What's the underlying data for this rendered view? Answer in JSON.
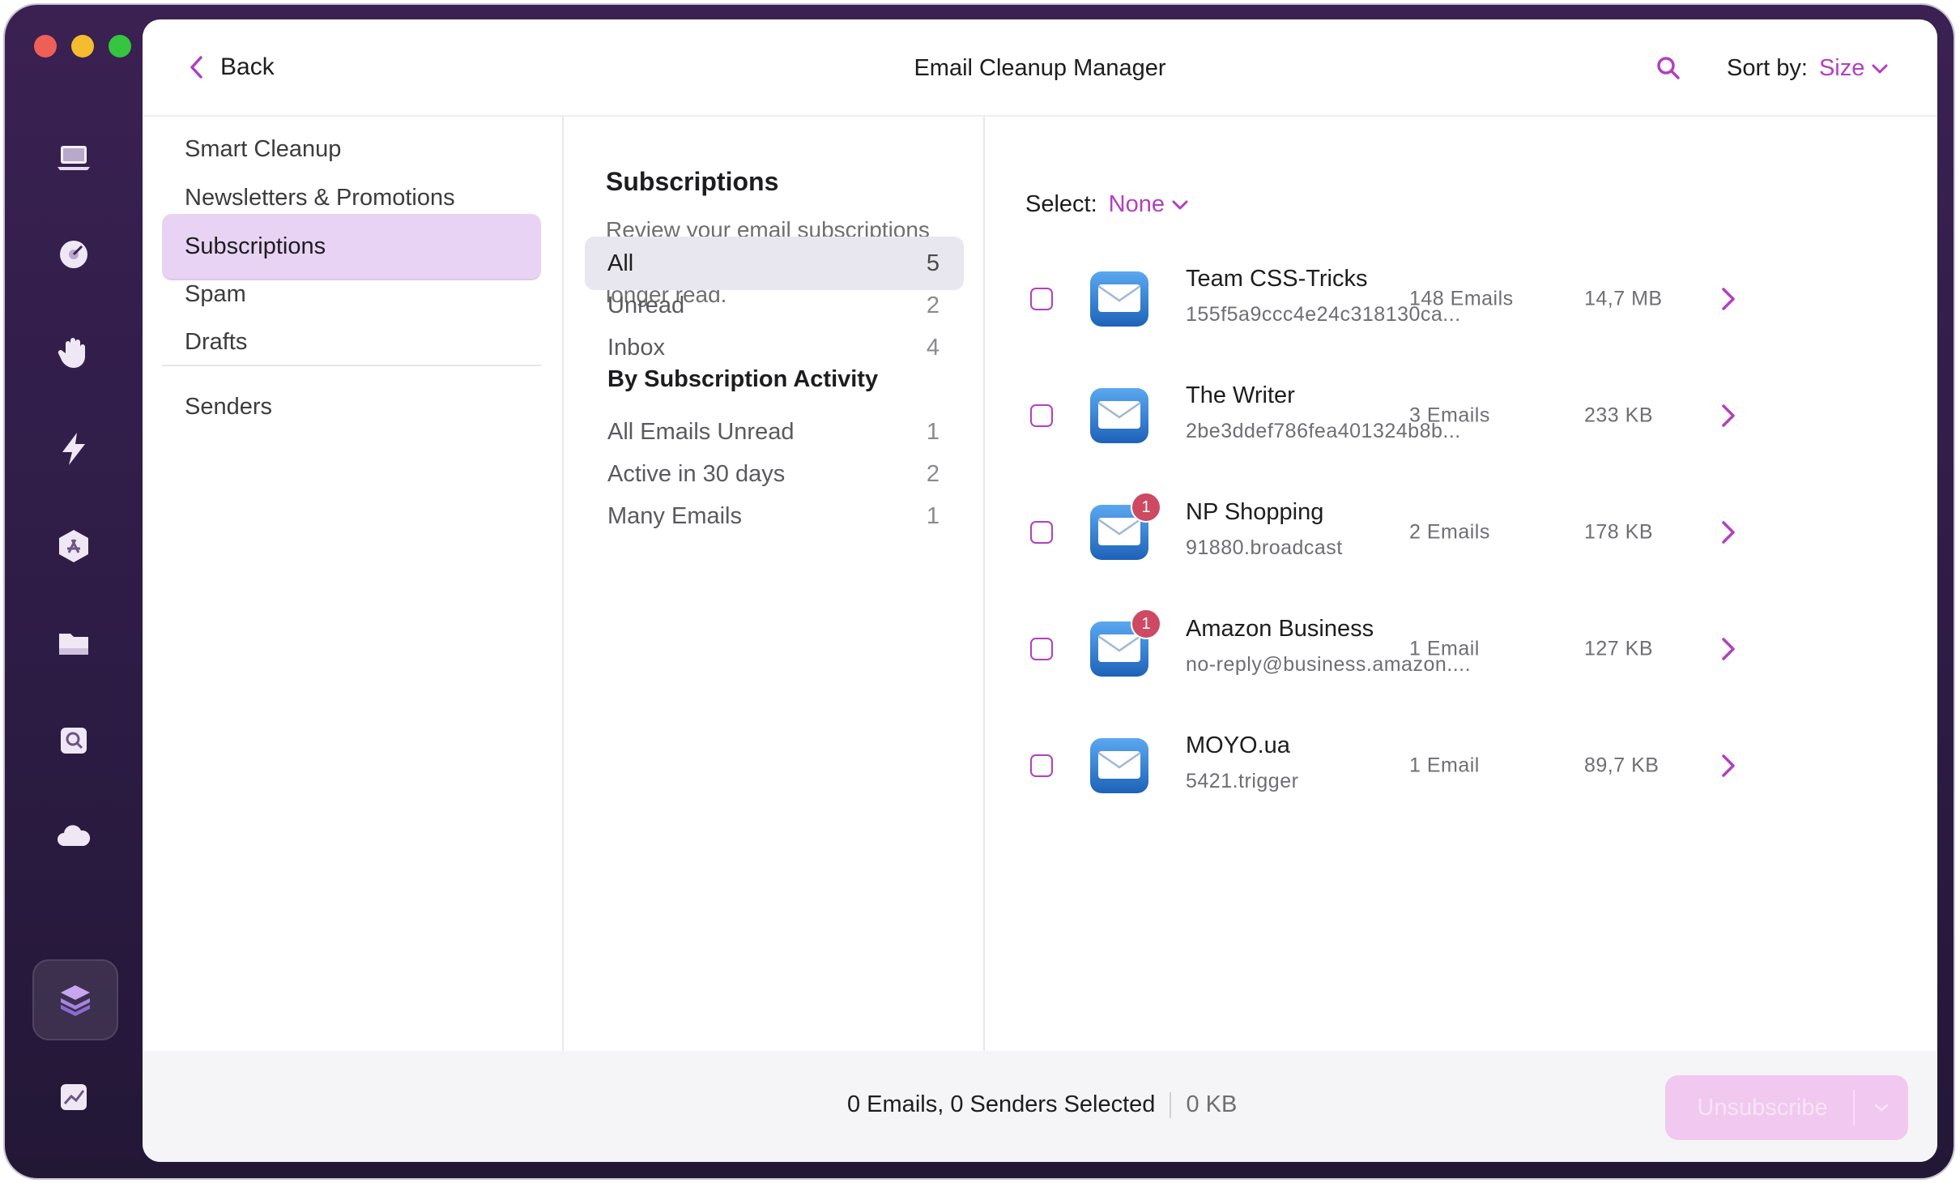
{
  "app": {
    "title": "Email Cleanup Manager",
    "back_label": "Back",
    "sort_label": "Sort by:",
    "sort_value": "Size",
    "accent_color": "#b23fbf"
  },
  "rail": {
    "icons": [
      "laptop-icon",
      "disk-icon",
      "hand-icon",
      "bolt-icon",
      "appstore-icon",
      "folder-icon",
      "finder-icon",
      "cloud-icon",
      "stack-icon",
      "chart-icon"
    ],
    "active": "stack-icon"
  },
  "categories": [
    {
      "label": "Smart Cleanup"
    },
    {
      "label": "Newsletters & Promotions"
    },
    {
      "label": "Subscriptions",
      "active": true
    },
    {
      "label": "Spam"
    },
    {
      "label": "Drafts"
    },
    {
      "label": "Senders"
    }
  ],
  "subscriptions": {
    "title": "Subscriptions",
    "description": "Review your email subscriptions and unsubscribe from those you no longer read.",
    "filters": [
      {
        "label": "All",
        "count": "5",
        "active": true
      },
      {
        "label": "Unread",
        "count": "2"
      },
      {
        "label": "Inbox",
        "count": "4"
      }
    ],
    "group_heading": "By Subscription Activity",
    "activity_filters": [
      {
        "label": "All Emails Unread",
        "count": "1"
      },
      {
        "label": "Active in 30 days",
        "count": "2"
      },
      {
        "label": "Many Emails",
        "count": "1"
      }
    ]
  },
  "list": {
    "select_label": "Select:",
    "select_value": "None",
    "senders": [
      {
        "name": "Team CSS-Tricks",
        "address": "155f5a9ccc4e24c318130ca...",
        "emails": "148 Emails",
        "size": "14,7 MB",
        "badge": ""
      },
      {
        "name": "The Writer",
        "address": "2be3ddef786fea401324b8b...",
        "emails": "3 Emails",
        "size": "233 KB",
        "badge": ""
      },
      {
        "name": "NP Shopping",
        "address": "91880.broadcast",
        "emails": "2 Emails",
        "size": "178 KB",
        "badge": "1"
      },
      {
        "name": "Amazon Business",
        "address": "no-reply@business.amazon....",
        "emails": "1 Email",
        "size": "127 KB",
        "badge": "1"
      },
      {
        "name": "MOYO.ua",
        "address": "5421.trigger",
        "emails": "1 Email",
        "size": "89,7 KB",
        "badge": ""
      }
    ]
  },
  "footer": {
    "selection": "0 Emails, 0 Senders Selected",
    "size": "0 KB",
    "unsubscribe_label": "Unsubscribe"
  }
}
